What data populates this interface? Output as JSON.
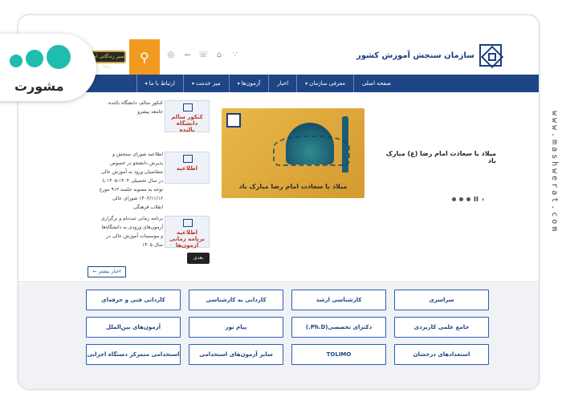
{
  "watermark": {
    "side_text": "www.mashwerat.com",
    "brand": "مشورت"
  },
  "header": {
    "site_name": "سازمان سنجش آموزش کشور",
    "plaque_text": "سیر زندگانی امام رضا",
    "search_icon": "search-icon",
    "icons": [
      "globe-icon",
      "share-icon",
      "phone-icon",
      "home-icon",
      "rss-icon"
    ]
  },
  "nav": {
    "items": [
      {
        "label": "صفحه اصلی",
        "caret": false
      },
      {
        "label": "معرفی سازمان",
        "caret": true
      },
      {
        "label": "اخبار",
        "caret": false
      },
      {
        "label": "آزمون‌ها",
        "caret": true
      },
      {
        "label": "میز خدمت",
        "caret": true
      },
      {
        "label": "ارتباط با ما",
        "caret": true
      }
    ]
  },
  "news": {
    "items": [
      {
        "text": "کنکور سالم، دانشگاه بالنده، جامعه پیشرو",
        "thumb": "کنکور سالم دانشگاه بالنده"
      },
      {
        "text": "اطلاعیه شورای سنجش و پذیرش دانشجو در خصوص متقاضیان ورود به آموزش عالی در سال تحصیلی ۱۴۰۴-۱۴۰۵ با توجه به مصوبه جلسه ۹۱۳ مورخ ۱۴۰۳/۱۱/۱۶ شورای عالی انقلاب فرهنگی",
        "thumb": "اطلاعیه"
      },
      {
        "text": "برنامه زمانی ثبت‌نام و برگزاری آزمون‌های ورودی به دانشگاه‌ها و موسسات آموزش عالی در سال ۱۴۰۵",
        "thumb": "اطلاعیه برنامه زمانی آزمون‌ها"
      }
    ],
    "next_label": "بعدی",
    "more_label": "اخبار بیشتر ←"
  },
  "slider": {
    "caption": "میلاد با سعادت امام رضا مبارک باد",
    "title": "میلاد با سعادت امام رضا (ع) مبارک باد",
    "controls": {
      "pause": "II",
      "prev": "‹",
      "next": "›"
    }
  },
  "exams": {
    "rows": [
      [
        "سراسری",
        "کارشناسی ارشد",
        "کاردانی به کارشناسی",
        "کاردانی فنی و حرفه‌ای"
      ],
      [
        "جامع علمی کاربردی",
        "دکترای تخصصی(Ph.D.)",
        "پیام نور",
        "آزمون‌های بین‌الملل"
      ],
      [
        "استعدادهای درخشان",
        "TOLIMO",
        "سایر آزمون‌های استخدامی",
        "استخدامی متمرکز دستگاه اجرایی"
      ]
    ]
  }
}
